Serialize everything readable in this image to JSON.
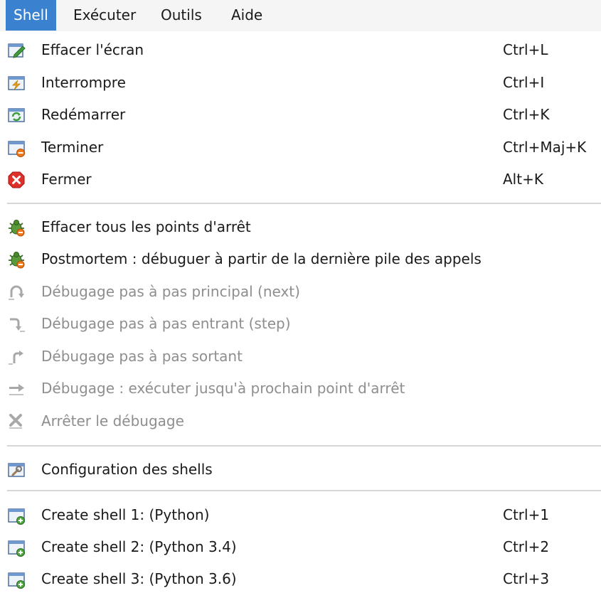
{
  "menubar": {
    "items": [
      "Shell",
      "Exécuter",
      "Outils",
      "Aide"
    ],
    "active": "Shell"
  },
  "menu": {
    "items": [
      {
        "label": "Effacer l'écran",
        "shortcut": "Ctrl+L",
        "icon": "clear-screen-icon",
        "enabled": true
      },
      {
        "label": "Interrompre",
        "shortcut": "Ctrl+I",
        "icon": "interrupt-icon",
        "enabled": true
      },
      {
        "label": "Redémarrer",
        "shortcut": "Ctrl+K",
        "icon": "restart-icon",
        "enabled": true
      },
      {
        "label": "Terminer",
        "shortcut": "Ctrl+Maj+K",
        "icon": "terminate-icon",
        "enabled": true
      },
      {
        "label": "Fermer",
        "shortcut": "Alt+K",
        "icon": "close-icon",
        "enabled": true
      },
      {
        "label": "Effacer tous les points d'arrêt",
        "shortcut": "",
        "icon": "bug-clear-icon",
        "enabled": true
      },
      {
        "label": "Postmortem : débuguer à partir de la dernière pile des appels",
        "shortcut": "",
        "icon": "bug-postmortem-icon",
        "enabled": true
      },
      {
        "label": "Débugage pas à pas principal (next)",
        "shortcut": "",
        "icon": "step-over-icon",
        "enabled": false
      },
      {
        "label": "Débugage pas à pas entrant (step)",
        "shortcut": "",
        "icon": "step-into-icon",
        "enabled": false
      },
      {
        "label": "Débugage pas à pas sortant",
        "shortcut": "",
        "icon": "step-out-icon",
        "enabled": false
      },
      {
        "label": "Débugage : exécuter jusqu'à prochain point d'arrêt",
        "shortcut": "",
        "icon": "continue-icon",
        "enabled": false
      },
      {
        "label": "Arrêter le débugage",
        "shortcut": "",
        "icon": "stop-debug-icon",
        "enabled": false
      },
      {
        "label": "Configuration des shells",
        "shortcut": "",
        "icon": "shell-config-icon",
        "enabled": true
      },
      {
        "label": "Create shell 1: (Python)",
        "shortcut": "Ctrl+1",
        "icon": "create-shell-icon",
        "enabled": true
      },
      {
        "label": "Create shell 2: (Python 3.4)",
        "shortcut": "Ctrl+2",
        "icon": "create-shell-icon",
        "enabled": true
      },
      {
        "label": "Create shell 3: (Python 3.6)",
        "shortcut": "Ctrl+3",
        "icon": "create-shell-icon",
        "enabled": true
      }
    ]
  },
  "colors": {
    "active_menu_bg": "#3a82d0",
    "disabled_text": "#8e8e8e",
    "separator": "#d6d6d6"
  }
}
